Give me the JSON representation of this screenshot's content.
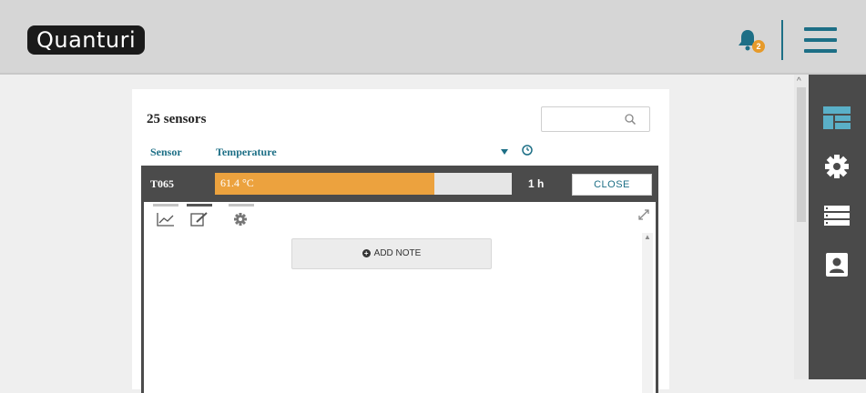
{
  "header": {
    "logo": "Quanturi",
    "notifications_badge": "2"
  },
  "sidebar": {
    "items": [
      {
        "icon": "dashboard-icon"
      },
      {
        "icon": "gear-icon"
      },
      {
        "icon": "list-icon"
      },
      {
        "icon": "contact-card-icon"
      }
    ]
  },
  "panel": {
    "title": "25 sensors",
    "search": {
      "placeholder": "",
      "value": ""
    },
    "columns": {
      "sensor": "Sensor",
      "temperature": "Temperature"
    },
    "sensor_row": {
      "id": "T065",
      "temperature": "61.4 °C",
      "temperature_fill_fraction": 0.74,
      "time_ago": "1 h",
      "close_label": "CLOSE"
    },
    "detail": {
      "tabs": [
        {
          "icon": "chart-icon",
          "active": false
        },
        {
          "icon": "edit-note-icon",
          "active": true
        },
        {
          "icon": "settings-icon",
          "active": false
        }
      ],
      "add_note_label": "ADD NOTE"
    }
  },
  "colors": {
    "accent": "#1d6f86",
    "temperature_bar": "#eca23e",
    "dark_row": "#4b4b4b",
    "sidebar": "#4a4a4a"
  }
}
